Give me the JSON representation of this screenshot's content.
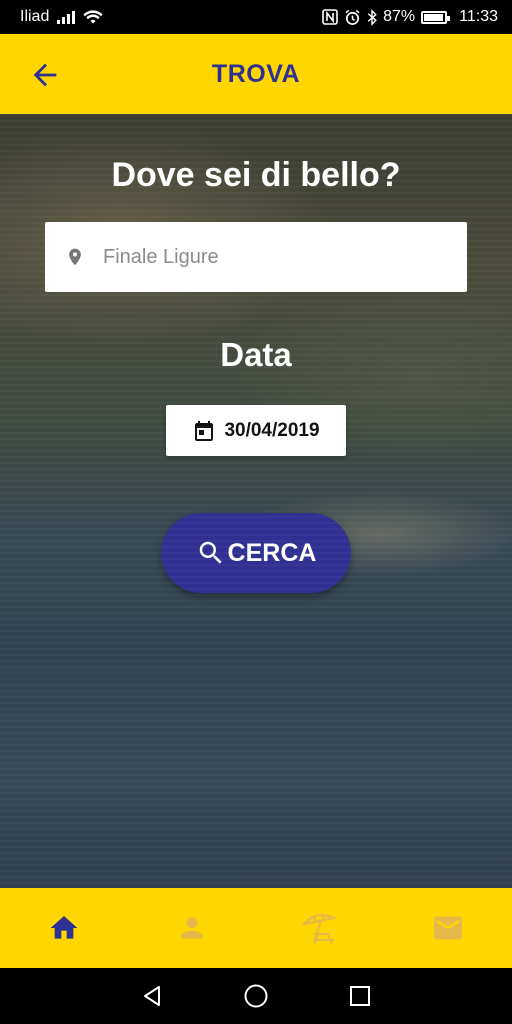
{
  "status_bar": {
    "carrier": "Iliad",
    "battery": "87%",
    "battery_level": 0.87,
    "time": "11:33",
    "icons": [
      "signal-icon",
      "wifi-icon",
      "nfc-icon",
      "alarm-icon",
      "bluetooth-icon",
      "battery-icon"
    ]
  },
  "app_bar": {
    "title": "TROVA",
    "back_icon": "arrow-back-icon"
  },
  "main": {
    "headline": "Dove sei di bello?",
    "location": {
      "placeholder": "Finale Ligure",
      "value": "",
      "icon": "location-pin-icon"
    },
    "date_label": "Data",
    "date": {
      "value": "30/04/2019",
      "icon": "calendar-icon"
    },
    "search_button": {
      "label": "CERCA",
      "icon": "search-icon"
    }
  },
  "bottom_nav": {
    "items": [
      {
        "id": "home",
        "icon": "home-icon",
        "active": true
      },
      {
        "id": "profile",
        "icon": "person-icon",
        "active": false
      },
      {
        "id": "beach",
        "icon": "beach-umbrella-icon",
        "active": false
      },
      {
        "id": "messages",
        "icon": "mail-icon",
        "active": false
      }
    ]
  },
  "colors": {
    "accent": "#FFD600",
    "primary": "#2E3192",
    "inactive_icon": "#E5B94A"
  }
}
